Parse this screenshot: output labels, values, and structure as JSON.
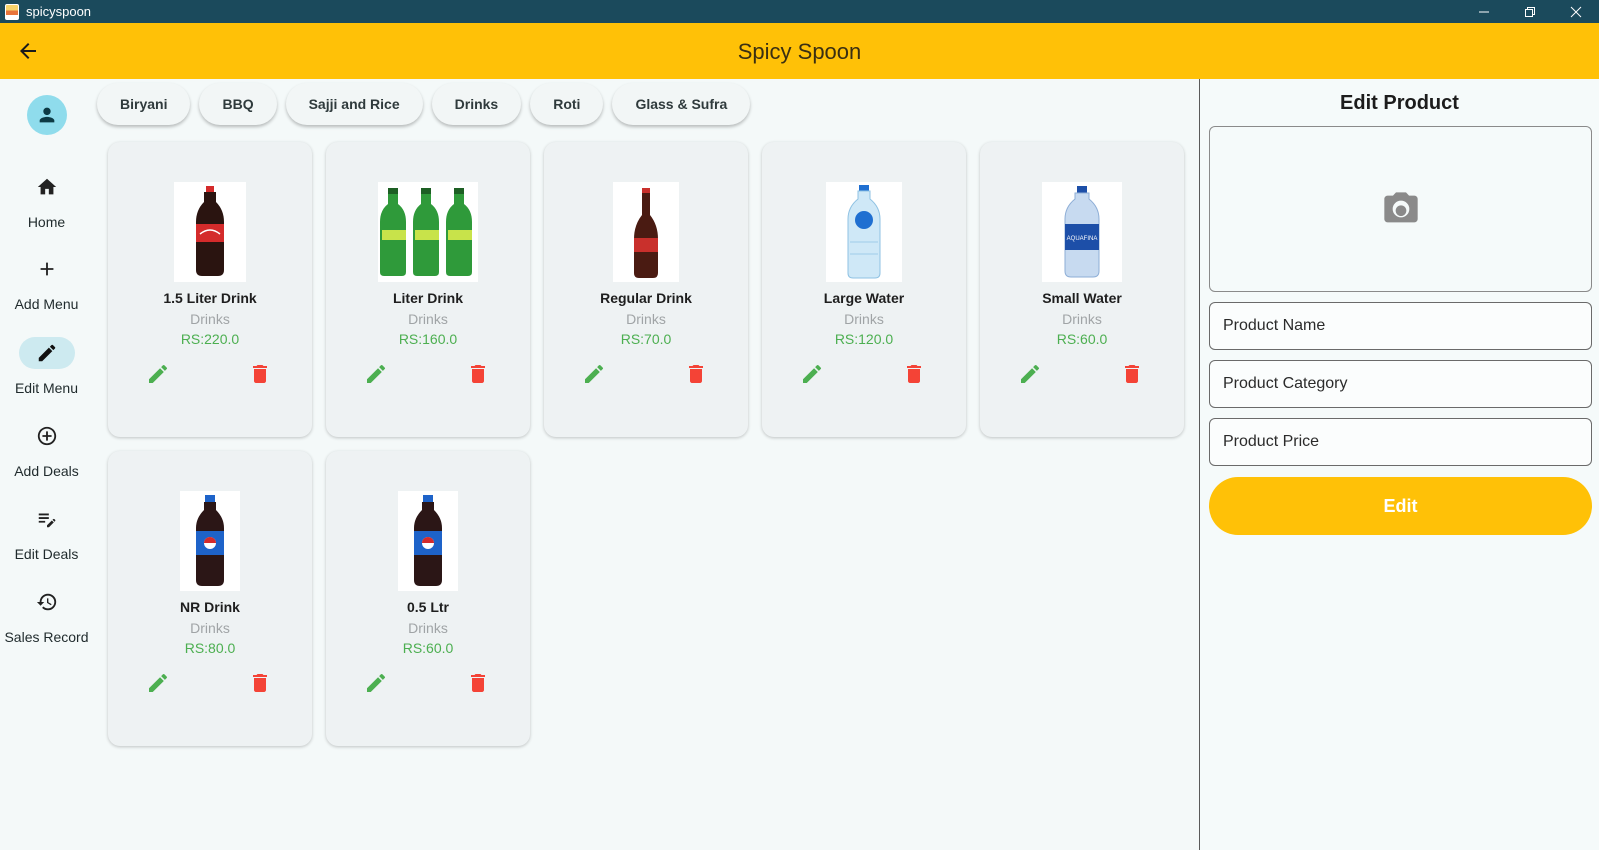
{
  "window": {
    "title": "spicyspoon",
    "controls": [
      "minimize-icon",
      "restore-icon",
      "close-icon"
    ]
  },
  "appbar": {
    "title": "Spicy Spoon",
    "back_icon": "arrow-back-icon",
    "background": "#ffc107"
  },
  "rail": {
    "items": [
      {
        "label": "Home",
        "icon": "home-icon"
      },
      {
        "label": "Add Menu",
        "icon": "plus-icon"
      },
      {
        "label": "Edit Menu",
        "icon": "pencil-icon",
        "active": true
      },
      {
        "label": "Add Deals",
        "icon": "add-circle-icon"
      },
      {
        "label": "Edit Deals",
        "icon": "edit-list-icon"
      },
      {
        "label": "Sales Record",
        "icon": "history-icon"
      }
    ]
  },
  "categories": [
    "Biryani",
    "BBQ",
    "Sajji and Rice",
    "Drinks",
    "Roti",
    "Glass & Sufra"
  ],
  "products": [
    {
      "name": "1.5 Liter Drink",
      "category": "Drinks",
      "price": "RS:220.0"
    },
    {
      "name": "Liter Drink",
      "category": "Drinks",
      "price": "RS:160.0"
    },
    {
      "name": "Regular Drink",
      "category": "Drinks",
      "price": "RS:70.0"
    },
    {
      "name": "Large Water",
      "category": "Drinks",
      "price": "RS:120.0"
    },
    {
      "name": "Small Water",
      "category": "Drinks",
      "price": "RS:60.0"
    },
    {
      "name": "NR Drink",
      "category": "Drinks",
      "price": "RS:80.0"
    },
    {
      "name": "0.5 Ltr",
      "category": "Drinks",
      "price": "RS:60.0"
    }
  ],
  "edit_panel": {
    "title": "Edit Product",
    "image_icon": "camera-icon",
    "name_placeholder": "Product Name",
    "category_placeholder": "Product Category",
    "price_placeholder": "Product Price",
    "submit_label": "Edit"
  },
  "colors": {
    "accent": "#ffc107",
    "titlebar": "#1b4a5c",
    "price": "#4caf50",
    "edit_icon": "#4caf50",
    "delete_icon": "#f44336"
  }
}
